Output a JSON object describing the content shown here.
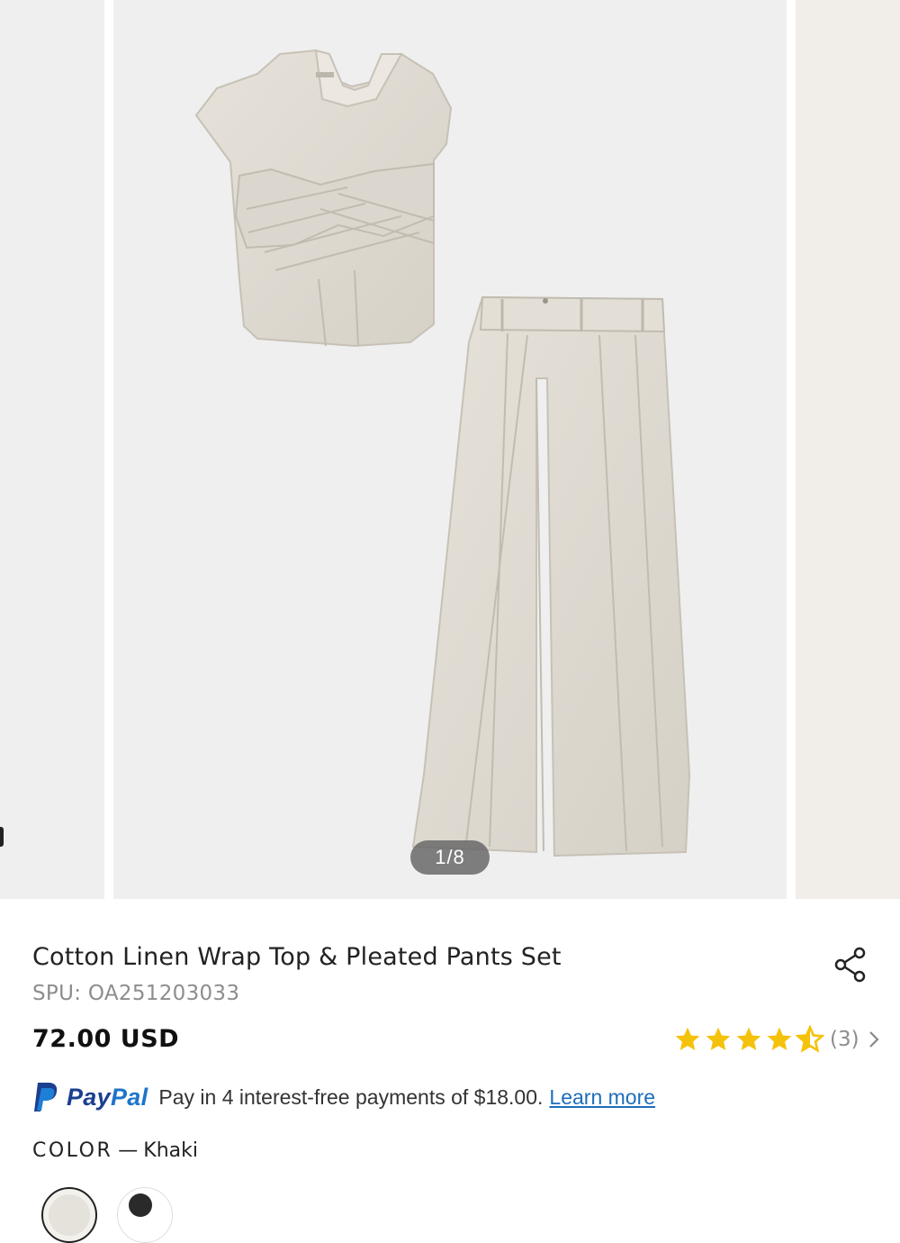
{
  "gallery": {
    "counter": "1/8"
  },
  "product": {
    "title": "Cotton Linen Wrap Top & Pleated Pants Set",
    "spu": "SPU: OA251203033",
    "price": "72.00 USD"
  },
  "rating": {
    "stars": 4.5,
    "max": 5,
    "count_label": "(3)",
    "star_color": "#f5c20b"
  },
  "paypal": {
    "brand_pay": "Pay",
    "brand_pal": "Pal",
    "text": "Pay in 4 interest-free payments of $18.00.",
    "link": "Learn more"
  },
  "color": {
    "label": "COLOR",
    "separator": "—",
    "value": "Khaki",
    "swatches": [
      "khaki",
      "black"
    ]
  },
  "icons": {
    "share": "share-icon",
    "chevron": "chevron-right-icon",
    "paypal": "paypal-icon"
  }
}
